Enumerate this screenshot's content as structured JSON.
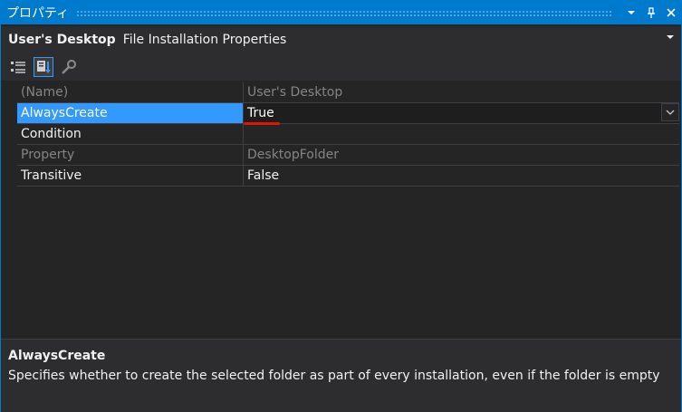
{
  "window": {
    "title": "プロパティ",
    "pin_glyph": "📌",
    "close_glyph": "✕"
  },
  "header": {
    "object_name": "User's Desktop",
    "object_type": "File Installation Properties"
  },
  "toolbar": {
    "icons": [
      "categorized-icon",
      "alphabetical-icon",
      "property-pages-icon"
    ]
  },
  "properties": [
    {
      "name": "(Name)",
      "value": "User's Desktop",
      "readonly": true
    },
    {
      "name": "AlwaysCreate",
      "value": "True",
      "selected": true
    },
    {
      "name": "Condition",
      "value": ""
    },
    {
      "name": "Property",
      "value": "DesktopFolder",
      "readonly": true
    },
    {
      "name": "Transitive",
      "value": "False"
    }
  ],
  "description": {
    "title": "AlwaysCreate",
    "text": "Specifies whether to create the selected folder as part of every installation, even if the folder is empty"
  },
  "colors": {
    "accent": "#007acc",
    "selection": "#3399ff",
    "annotation": "#e51400"
  }
}
